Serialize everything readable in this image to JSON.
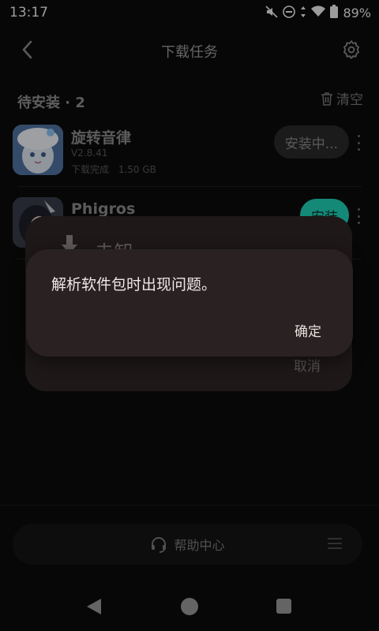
{
  "status": {
    "time": "13:17",
    "battery": "89%",
    "icons": [
      "mute-icon",
      "dnd-icon",
      "data-arrows-icon",
      "wifi-icon",
      "battery-icon"
    ]
  },
  "appbar": {
    "title": "下载任务"
  },
  "section": {
    "title": "待安装 · 2",
    "clear_label": "清空"
  },
  "apps": [
    {
      "name": "旋转音律",
      "version": "V2.8.41",
      "status": "下载完成",
      "size": "1.50 GB",
      "action": "安装中..."
    },
    {
      "name": "Phigros",
      "action": "安装"
    }
  ],
  "sheet": {
    "label": "去卸",
    "cancel": "取消"
  },
  "dialog": {
    "message": "解析软件包时出现问题。",
    "ok": "确定"
  },
  "bottom": {
    "help": "帮助中心"
  },
  "colors": {
    "accent": "#1fd3b8",
    "pill_gray": "#2a2a2a"
  }
}
